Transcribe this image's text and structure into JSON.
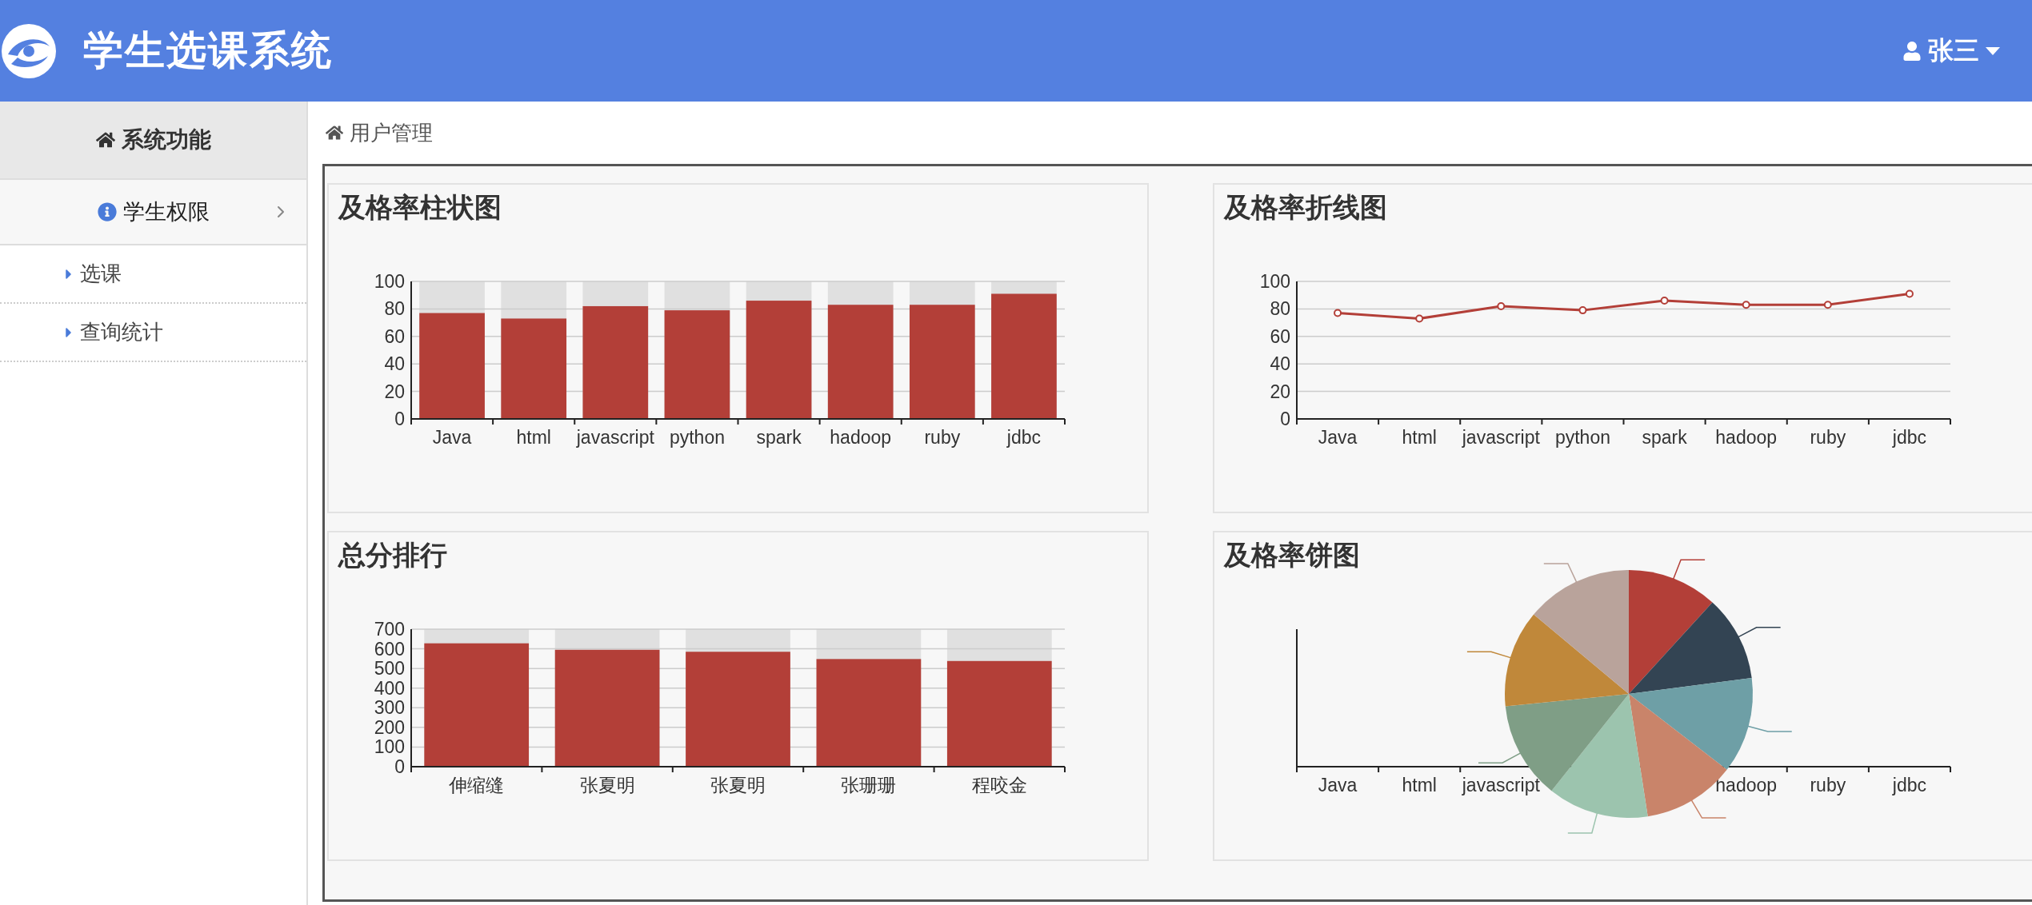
{
  "header": {
    "title": "学生选课系统",
    "user": "张三"
  },
  "sidebar": {
    "title": "系统功能",
    "sections": [
      {
        "label": "学生权限",
        "items": [
          {
            "label": "选课"
          },
          {
            "label": "查询统计"
          }
        ]
      }
    ]
  },
  "breadcrumb": {
    "label": "用户管理"
  },
  "panels": [
    {
      "kind": "chart",
      "title": "及格率柱状图",
      "chart_data": {
        "type": "bar",
        "grid": true,
        "categories": [
          "Java",
          "html",
          "javascript",
          "python",
          "spark",
          "hadoop",
          "ruby",
          "jdbc"
        ],
        "values": [
          77,
          73,
          82,
          79,
          86,
          83,
          83,
          91
        ],
        "ylim": [
          0,
          100
        ],
        "yticks": [
          0,
          20,
          40,
          60,
          80,
          100
        ]
      }
    },
    {
      "kind": "chart",
      "title": "及格率折线图",
      "chart_data": {
        "type": "line",
        "grid": true,
        "categories": [
          "Java",
          "html",
          "javascript",
          "python",
          "spark",
          "hadoop",
          "ruby",
          "jdbc"
        ],
        "series": [
          {
            "color": "#b33f38",
            "marker": "circle",
            "values": [
              77,
              73,
              82,
              79,
              86,
              83,
              83,
              91
            ]
          }
        ],
        "ylim": [
          0,
          100
        ],
        "yticks": [
          0,
          20,
          40,
          60,
          80,
          100
        ]
      }
    },
    {
      "kind": "chart",
      "title": "总分排行",
      "chart_data": {
        "type": "bar",
        "grid": true,
        "categories": [
          "伸缩缝",
          "张夏明",
          "张夏明",
          "张珊珊",
          "程咬金"
        ],
        "values": [
          628,
          595,
          585,
          548,
          538
        ],
        "ylim": [
          0,
          700
        ],
        "yticks": [
          0,
          100,
          200,
          300,
          400,
          500,
          600,
          700
        ]
      }
    },
    {
      "kind": "pie",
      "title": "及格率饼图",
      "axis_labels_left": [
        "Java",
        "html",
        "javascript"
      ],
      "axis_labels_right": [
        "hadoop",
        "ruby",
        "jdbc"
      ],
      "slices": [
        {
          "color": "#b33f38"
        },
        {
          "color": "#334453"
        },
        {
          "color": "#6e9fa6"
        },
        {
          "color": "#c9846a"
        },
        {
          "color": "#9cc4ae"
        },
        {
          "color": "#7f9e86"
        },
        {
          "color": "#c0883a"
        },
        {
          "color": "#b9a39b"
        }
      ]
    }
  ]
}
